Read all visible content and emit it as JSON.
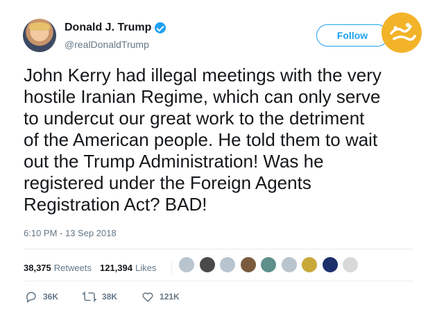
{
  "tweet": {
    "display_name": "Donald J. Trump",
    "handle": "@realDonaldTrump",
    "follow_label": "Follow",
    "text": "John Kerry had illegal meetings with the very\nhostile Iranian Regime, which can only serve\nto undercut our great work to the detriment\nof the American people. He told them to wait\nout the Trump Administration! Was he\nregistered under the Foreign Agents\nRegistration Act? BAD!",
    "timestamp": "6:10 PM - 13 Sep 2018",
    "stats": {
      "retweets_count": "38,375",
      "retweets_label": "Retweets",
      "likes_count": "121,394",
      "likes_label": "Likes"
    },
    "actions": {
      "reply_count": "36K",
      "retweet_count": "38K",
      "like_count": "121K"
    }
  },
  "likers": [
    {
      "icon": "default-avatar",
      "color": "#b8c4ce"
    },
    {
      "icon": "user-avatar",
      "color": "#4a4a4a"
    },
    {
      "icon": "default-avatar",
      "color": "#b8c4ce"
    },
    {
      "icon": "user-avatar",
      "color": "#7a5b3d"
    },
    {
      "icon": "user-avatar",
      "color": "#5f8f8a"
    },
    {
      "icon": "default-avatar",
      "color": "#b8c4ce"
    },
    {
      "icon": "user-avatar",
      "color": "#c9a83a"
    },
    {
      "icon": "user-avatar",
      "color": "#1c2f6b"
    },
    {
      "icon": "user-avatar",
      "color": "#d9d9d9"
    }
  ],
  "colors": {
    "accent": "#1da1f2",
    "muted": "#657786",
    "watermark": "#f3b329"
  }
}
